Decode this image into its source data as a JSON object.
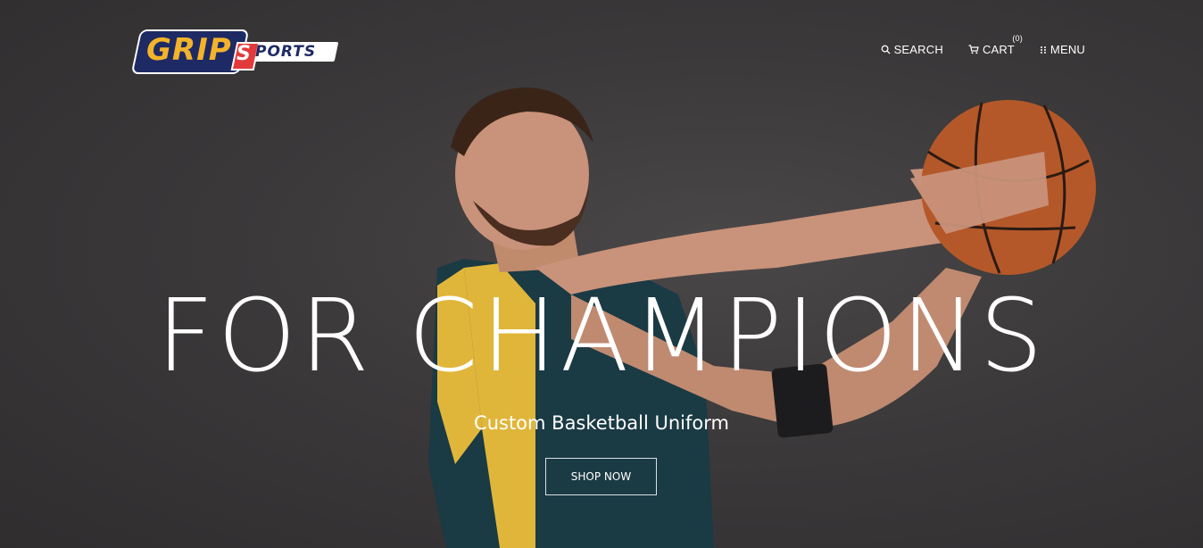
{
  "header": {
    "logo": {
      "grip": "GRIP",
      "s": "S",
      "ports": "PORTS"
    },
    "nav": {
      "search_label": "SEARCH",
      "cart_label": "CART",
      "cart_count": "(0)",
      "menu_label": "MENU"
    }
  },
  "hero": {
    "headline": "FOR CHAMPIONS",
    "subheadline": "Custom Basketball Uniform",
    "cta_label": "SHOP NOW"
  },
  "colors": {
    "background": "#3a3839",
    "logo_navy": "#1e2a63",
    "logo_gold": "#f3b32a",
    "logo_red": "#e23a3a",
    "text": "#ffffff"
  },
  "icons": {
    "search": "search-icon",
    "cart": "cart-icon",
    "menu": "menu-dots-icon"
  }
}
